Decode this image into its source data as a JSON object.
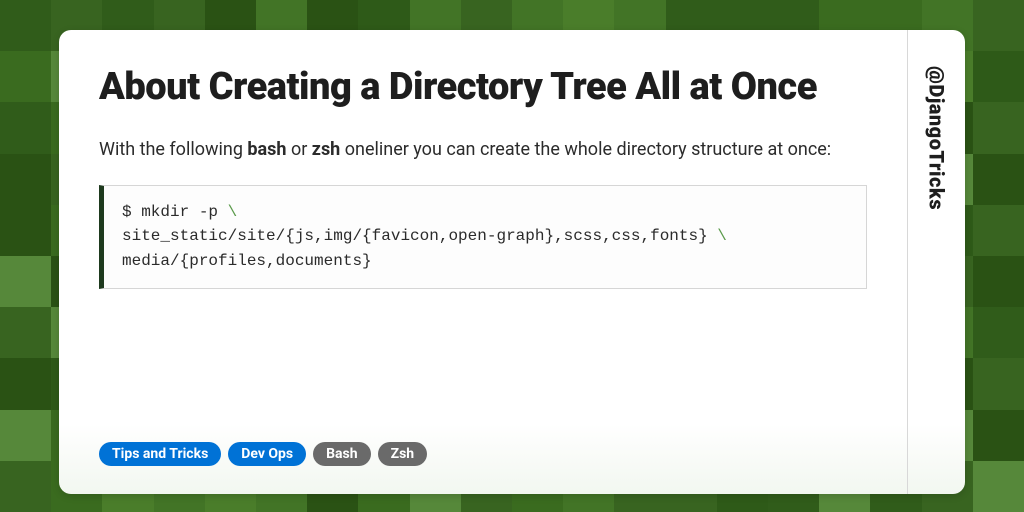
{
  "handle": "@DjangoTricks",
  "title": "About Creating a Directory Tree All at Once",
  "description": {
    "pre": "With the following ",
    "b1": "bash",
    "mid": " or ",
    "b2": "zsh",
    "post": " oneliner you can create the whole directory structure at once:"
  },
  "code": {
    "line1": "$ mkdir -p ",
    "line2": "site_static/site/{js,img/{favicon,open-graph},scss,css,fonts} ",
    "line3": "media/{profiles,documents}",
    "backslash": "\\"
  },
  "tags": [
    {
      "label": "Tips and Tricks",
      "cls": "blue"
    },
    {
      "label": "Dev Ops",
      "cls": "blue"
    },
    {
      "label": "Bash",
      "cls": "gray"
    },
    {
      "label": "Zsh",
      "cls": "gray"
    }
  ],
  "bg_colors": [
    "#2e5a18",
    "#3a6b1f",
    "#4a7d2a",
    "#56883a",
    "#2a5214",
    "#427426",
    "#386420",
    "#305c1a"
  ]
}
